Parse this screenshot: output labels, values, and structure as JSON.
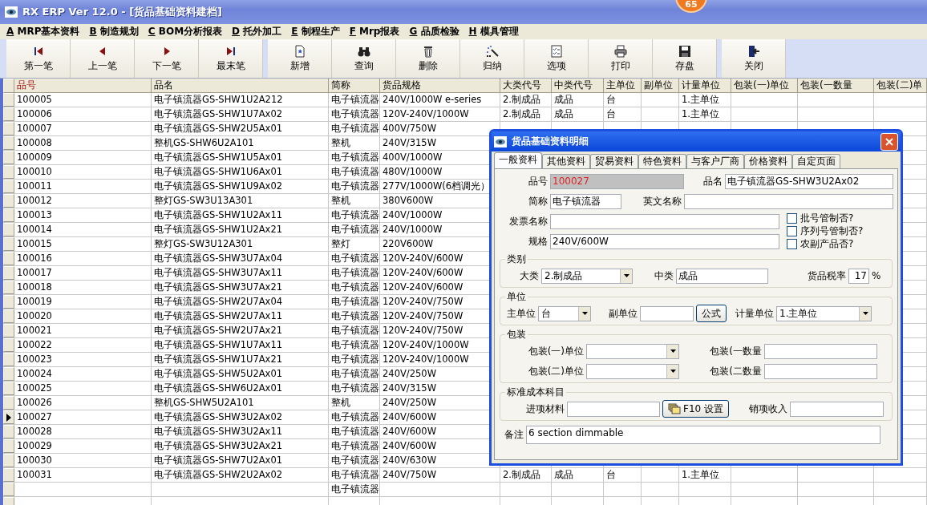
{
  "window": {
    "title": "RX ERP Ver 12.0 - [货品基础资料建档]"
  },
  "badge": {
    "text": "65"
  },
  "menu": [
    {
      "key": "A",
      "label": " MRP基本资料"
    },
    {
      "key": "B",
      "label": " 制造规划"
    },
    {
      "key": "C",
      "label": " BOM分析报表"
    },
    {
      "key": "D",
      "label": " 托外加工"
    },
    {
      "key": "E",
      "label": " 制程生产"
    },
    {
      "key": "F",
      "label": " Mrp报表"
    },
    {
      "key": "G",
      "label": " 品质检验"
    },
    {
      "key": "H",
      "label": " 模具管理"
    }
  ],
  "toolbar": [
    [
      {
        "label": "第一笔",
        "kind": "first"
      },
      {
        "label": "上一笔",
        "kind": "prev"
      },
      {
        "label": "下一笔",
        "kind": "next"
      },
      {
        "label": "最末笔",
        "kind": "last"
      }
    ],
    [
      {
        "label": "新增",
        "kind": "new"
      },
      {
        "label": "查询",
        "kind": "search"
      },
      {
        "label": "删除",
        "kind": "delete"
      },
      {
        "label": "归纳",
        "kind": "wand"
      },
      {
        "label": "选项",
        "kind": "options"
      },
      {
        "label": "打印",
        "kind": "print"
      },
      {
        "label": "存盘",
        "kind": "save"
      }
    ],
    [
      {
        "label": "关闭",
        "kind": "exit"
      }
    ]
  ],
  "grid": {
    "columns": [
      {
        "label": "品号",
        "selected": true
      },
      {
        "label": "品名",
        "selected": false
      },
      {
        "label": "简称",
        "selected": false
      },
      {
        "label": "货品规格",
        "selected": false
      },
      {
        "label": "大类代号",
        "selected": false
      },
      {
        "label": "中类代号",
        "selected": false
      },
      {
        "label": "主单位",
        "selected": false
      },
      {
        "label": "副单位",
        "selected": false
      },
      {
        "label": "计量单位",
        "selected": false
      },
      {
        "label": "包装(一)单位",
        "selected": false
      },
      {
        "label": "包装(一数量",
        "selected": false
      },
      {
        "label": "包装(二)单",
        "selected": false
      }
    ],
    "rows": [
      {
        "selected": false,
        "cells": [
          "100005",
          "电子镇流器GS-SHW1U2A212",
          "电子镇流器",
          "240V/1000W  e-series",
          "2.制成品",
          "成品",
          "台",
          null,
          "1.主单位"
        ]
      },
      {
        "selected": false,
        "cells": [
          "100006",
          "电子镇流器GS-SHW1U7Ax02",
          "电子镇流器",
          "120V-240V/1000W",
          "2.制成品",
          "成品",
          "台",
          null,
          "1.主单位"
        ]
      },
      {
        "selected": false,
        "cells": [
          "100007",
          "电子镇流器GS-SHW2U5Ax01",
          "电子镇流器",
          "400V/750W"
        ]
      },
      {
        "selected": false,
        "cells": [
          "100008",
          "整机GS-SHW6U2A101",
          "整机",
          "240V/315W"
        ]
      },
      {
        "selected": false,
        "cells": [
          "100009",
          "电子镇流器GS-SHW1U5Ax01",
          "电子镇流器",
          "400V/1000W"
        ]
      },
      {
        "selected": false,
        "cells": [
          "100010",
          "电子镇流器GS-SHW1U6Ax01",
          "电子镇流器",
          "480V/1000W"
        ]
      },
      {
        "selected": false,
        "cells": [
          "100011",
          "电子镇流器GS-SHW1U9Ax02",
          "电子镇流器",
          "277V/1000W(6档调光）"
        ]
      },
      {
        "selected": false,
        "cells": [
          "100012",
          "整灯GS-SW3U13A301",
          "整机",
          "380V600W"
        ]
      },
      {
        "selected": false,
        "cells": [
          "100013",
          "电子镇流器GS-SHW1U2Ax11",
          "电子镇流器",
          "240V/1000W"
        ]
      },
      {
        "selected": false,
        "cells": [
          "100014",
          "电子镇流器GS-SHW1U2Ax21",
          "电子镇流器",
          "240V/1000W"
        ]
      },
      {
        "selected": false,
        "cells": [
          "100015",
          "整灯GS-SW3U12A301",
          "整灯",
          "220V600W"
        ]
      },
      {
        "selected": false,
        "cells": [
          "100016",
          "电子镇流器GS-SHW3U7Ax04",
          "电子镇流器",
          "120V-240V/600W"
        ]
      },
      {
        "selected": false,
        "cells": [
          "100017",
          "电子镇流器GS-SHW3U7Ax11",
          "电子镇流器",
          "120V-240V/600W"
        ]
      },
      {
        "selected": false,
        "cells": [
          "100018",
          "电子镇流器GS-SHW3U7Ax21",
          "电子镇流器",
          "120V-240V/600W"
        ]
      },
      {
        "selected": false,
        "cells": [
          "100019",
          "电子镇流器GS-SHW2U7Ax04",
          "电子镇流器",
          "120V-240V/750W"
        ]
      },
      {
        "selected": false,
        "cells": [
          "100020",
          "电子镇流器GS-SHW2U7Ax11",
          "电子镇流器",
          "120V-240V/750W"
        ]
      },
      {
        "selected": false,
        "cells": [
          "100021",
          "电子镇流器GS-SHW2U7Ax21",
          "电子镇流器",
          "120V-240V/750W"
        ]
      },
      {
        "selected": false,
        "cells": [
          "100022",
          "电子镇流器GS-SHW1U7Ax11",
          "电子镇流器",
          "120V-240V/1000W"
        ]
      },
      {
        "selected": false,
        "cells": [
          "100023",
          "电子镇流器GS-SHW1U7Ax21",
          "电子镇流器",
          "120V-240V/1000W"
        ]
      },
      {
        "selected": false,
        "cells": [
          "100024",
          "电子镇流器GS-SHW5U2Ax01",
          "电子镇流器",
          "240V/250W"
        ]
      },
      {
        "selected": false,
        "cells": [
          "100025",
          "电子镇流器GS-SHW6U2Ax01",
          "电子镇流器",
          "240V/315W"
        ]
      },
      {
        "selected": false,
        "cells": [
          "100026",
          "整机GS-SHW5U2A101",
          "整机",
          "240V/250W"
        ]
      },
      {
        "selected": true,
        "cells": [
          "100027",
          "电子镇流器GS-SHW3U2Ax02",
          "电子镇流器",
          "240V/600W"
        ]
      },
      {
        "selected": false,
        "cells": [
          "100028",
          "电子镇流器GS-SHW3U2Ax11",
          "电子镇流器",
          "240V/600W"
        ]
      },
      {
        "selected": false,
        "cells": [
          "100029",
          "电子镇流器GS-SHW3U2Ax21",
          "电子镇流器",
          "240V/600W"
        ]
      },
      {
        "selected": false,
        "cells": [
          "100030",
          "电子镇流器GS-SHW7U2Ax01",
          "电子镇流器",
          "240V/630W"
        ]
      },
      {
        "selected": false,
        "cells": [
          "100031",
          "电子镇流器GS-SHW2U2Ax02",
          "电子镇流器",
          "240V/750W",
          "2.制成品",
          "成品",
          "台",
          null,
          "1.主单位"
        ]
      },
      {
        "selected": false,
        "cells": [
          null,
          null,
          "电子镇流器"
        ]
      },
      {
        "selected": false,
        "cells": []
      }
    ]
  },
  "dialog": {
    "title": "货品基础资料明细",
    "tabs": [
      {
        "label": "一般资料",
        "selected": true
      },
      {
        "label": "其他资料",
        "selected": false
      },
      {
        "label": "贸易资料",
        "selected": false
      },
      {
        "label": "特色资料",
        "selected": false
      },
      {
        "label": "与客户厂商",
        "selected": false
      },
      {
        "label": "价格资料",
        "selected": false
      },
      {
        "label": "自定页面",
        "selected": false
      }
    ],
    "item_no": {
      "label": "品号",
      "value": "100027",
      "disabled": true
    },
    "item_name": {
      "label": "品名",
      "value": "电子镇流器GS-SHW3U2Ax02"
    },
    "short_name": {
      "label": "简称",
      "value": "电子镇流器"
    },
    "english_name": {
      "label": "英文名称"
    },
    "invoice_name": {
      "label": "发票名称"
    },
    "spec": {
      "label": "规格",
      "value": "240V/600W"
    },
    "checkboxes": [
      {
        "label": "批号管制否?",
        "checked": false
      },
      {
        "label": "序列号管制否?",
        "checked": false
      },
      {
        "label": "农副产品否?",
        "checked": false
      }
    ],
    "category": {
      "title": "类别",
      "major": {
        "label": "大类",
        "value": "2.制成品"
      },
      "middle": {
        "label": "中类",
        "value": "成品"
      },
      "tax": {
        "label": "货品税率",
        "value": "17",
        "unit": "%"
      }
    },
    "unit": {
      "title": "单位",
      "main": {
        "label": "主单位",
        "value": "台"
      },
      "sub": {
        "label": "副单位"
      },
      "formula_button": "公式",
      "measure": {
        "label": "计量单位",
        "value": "1.主单位"
      }
    },
    "packing": {
      "title": "包装",
      "rows": [
        {
          "unit_label": "包装(一)单位",
          "qty_label": "包装(一数量"
        },
        {
          "unit_label": "包装(二)单位",
          "qty_label": "包装(二数量"
        }
      ]
    },
    "cost": {
      "title": "标准成本科目",
      "input_label": "进项材料",
      "button": "F10 设置",
      "output_label": "销项收入"
    },
    "remark": {
      "label": "备注",
      "value": "6 section dimmable"
    }
  }
}
